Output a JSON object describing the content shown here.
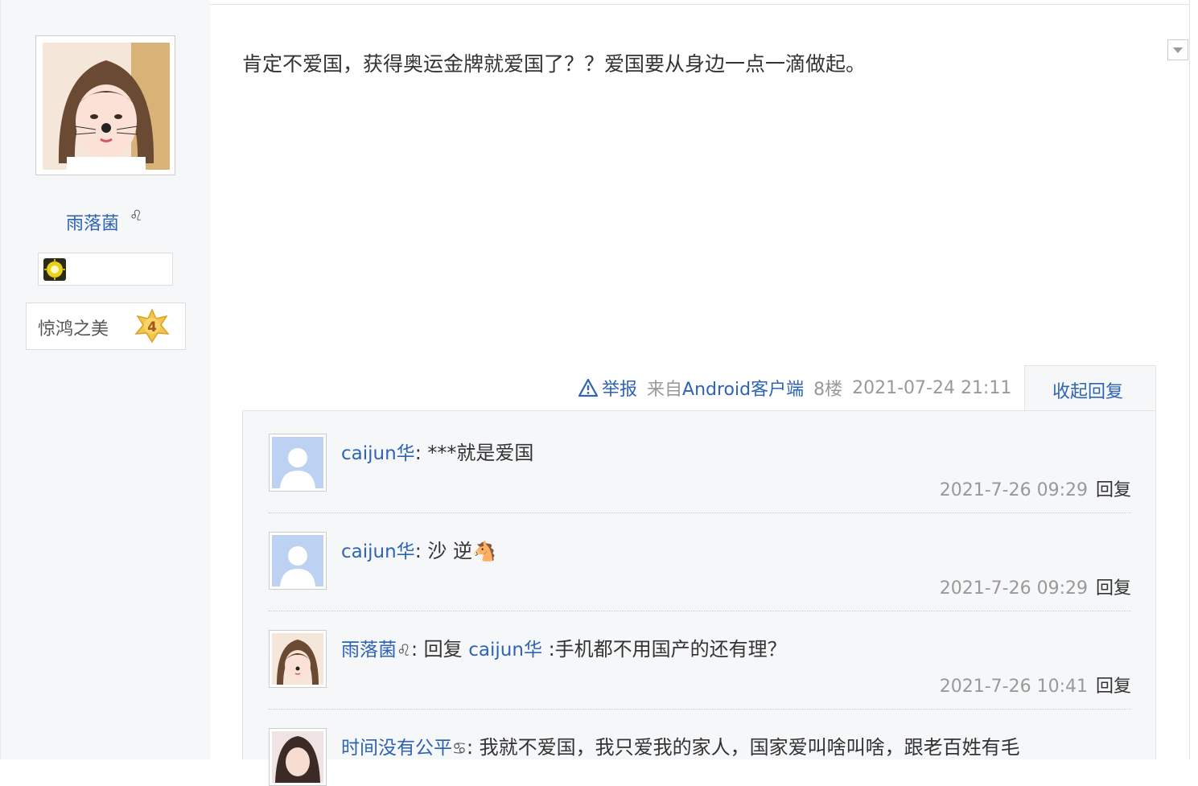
{
  "author": {
    "name": "雨落菌",
    "gender_symbol": "♌",
    "level_title": "惊鸿之美",
    "level_number": "4"
  },
  "post": {
    "content": "肯定不爱国，获得奥运金牌就爱国了？？爱国要从身边一点一滴做起。",
    "report_label": "举报",
    "source_prefix": "来自",
    "source_client": "Android客户端",
    "floor": "8楼",
    "time": "2021-07-24 21:11",
    "collapse_label": "收起回复"
  },
  "replies": [
    {
      "user": "caijun华",
      "user_symbol": "",
      "reply_prefix": "",
      "reply_to": "",
      "text": ": ***就是爱国",
      "time": "2021-7-26 09:29",
      "reply_label": "回复",
      "avatar": "default-avatar"
    },
    {
      "user": "caijun华",
      "user_symbol": "",
      "reply_prefix": "",
      "reply_to": "",
      "text": ": 沙 逆🐴",
      "time": "2021-7-26 09:29",
      "reply_label": "回复",
      "avatar": "default-avatar"
    },
    {
      "user": "雨落菌",
      "user_symbol": "♌",
      "reply_prefix": ": 回复 ",
      "reply_to": "caijun华",
      "text": " :手机都不用国产的还有理？",
      "time": "2021-7-26 10:41",
      "reply_label": "回复",
      "avatar": "girl-cat-avatar"
    },
    {
      "user": "时间没有公平",
      "user_symbol": "♋",
      "reply_prefix": "",
      "reply_to": "",
      "text": ": 我就不爱国，我只爱我的家人，国家爱叫啥叫啥，跟老百姓有毛",
      "time": "",
      "reply_label": "",
      "avatar": "girl-avatar"
    }
  ],
  "colors": {
    "link": "#2d64b3",
    "muted": "#999999",
    "panel_bg": "#f6f7f9",
    "border": "#e3e3e3"
  }
}
